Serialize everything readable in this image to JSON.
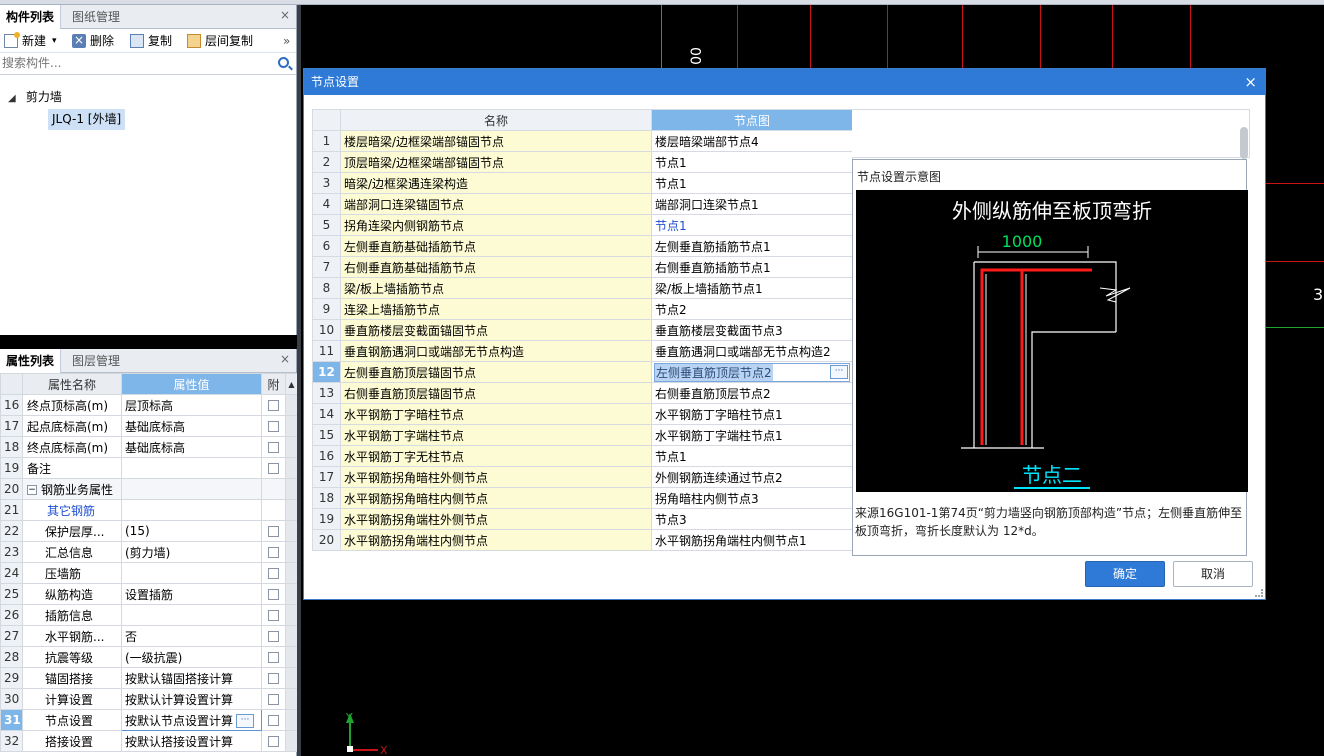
{
  "component_panel": {
    "tabs": [
      "构件列表",
      "图纸管理"
    ],
    "close": "×",
    "toolbar": {
      "new": "新建",
      "delete": "删除",
      "copy": "复制",
      "floor_copy": "层间复制",
      "more": "»"
    },
    "search_placeholder": "搜索构件...",
    "tree": {
      "root": "剪力墙",
      "child": "JLQ-1 [外墙]"
    }
  },
  "property_panel": {
    "tabs": [
      "属性列表",
      "图层管理"
    ],
    "close": "×",
    "headers": {
      "name": "属性名称",
      "value": "属性值",
      "extra": "附"
    },
    "rows": [
      {
        "num": "16",
        "name": "终点顶标高(m)",
        "value": "层顶标高",
        "check": true
      },
      {
        "num": "17",
        "name": "起点底标高(m)",
        "value": "基础底标高",
        "check": true
      },
      {
        "num": "18",
        "name": "终点底标高(m)",
        "value": "基础底标高",
        "check": true
      },
      {
        "num": "19",
        "name": "备注",
        "value": "",
        "check": true
      },
      {
        "num": "20",
        "name": "钢筋业务属性",
        "value": "",
        "check": false,
        "group": true
      },
      {
        "num": "21",
        "name": "其它钢筋",
        "value": "",
        "check": false,
        "link": true
      },
      {
        "num": "22",
        "name": "保护层厚...",
        "value": "(15)",
        "check": true
      },
      {
        "num": "23",
        "name": "汇总信息",
        "value": "(剪力墙)",
        "check": true
      },
      {
        "num": "24",
        "name": "压墙筋",
        "value": "",
        "check": true
      },
      {
        "num": "25",
        "name": "纵筋构造",
        "value": "设置插筋",
        "check": true
      },
      {
        "num": "26",
        "name": "插筋信息",
        "value": "",
        "check": true
      },
      {
        "num": "27",
        "name": "水平钢筋...",
        "value": "否",
        "check": true
      },
      {
        "num": "28",
        "name": "抗震等级",
        "value": "(一级抗震)",
        "check": true
      },
      {
        "num": "29",
        "name": "锚固搭接",
        "value": "按默认锚固搭接计算",
        "check": true
      },
      {
        "num": "30",
        "name": "计算设置",
        "value": "按默认计算设置计算",
        "check": true
      },
      {
        "num": "31",
        "name": "节点设置",
        "value": "按默认节点设置计算",
        "check": true,
        "selected": true
      },
      {
        "num": "32",
        "name": "搭接设置",
        "value": "按默认搭接设置计算",
        "check": true
      }
    ]
  },
  "dialog": {
    "title": "节点设置",
    "close": "×",
    "headers": {
      "name": "名称",
      "image": "节点图"
    },
    "rows": [
      {
        "num": "1",
        "name": "楼层暗梁/边框梁端部锚固节点",
        "image": "楼层暗梁端部节点4"
      },
      {
        "num": "2",
        "name": "顶层暗梁/边框梁端部锚固节点",
        "image": "节点1"
      },
      {
        "num": "3",
        "name": "暗梁/边框梁遇连梁构造",
        "image": "节点1"
      },
      {
        "num": "4",
        "name": "端部洞口连梁锚固节点",
        "image": "端部洞口连梁节点1"
      },
      {
        "num": "5",
        "name": "拐角连梁内侧钢筋节点",
        "image": "节点1",
        "link": true
      },
      {
        "num": "6",
        "name": "左侧垂直筋基础插筋节点",
        "image": "左侧垂直筋插筋节点1"
      },
      {
        "num": "7",
        "name": "右侧垂直筋基础插筋节点",
        "image": "右侧垂直筋插筋节点1"
      },
      {
        "num": "8",
        "name": "梁/板上墙插筋节点",
        "image": "梁/板上墙插筋节点1"
      },
      {
        "num": "9",
        "name": "连梁上墙插筋节点",
        "image": "节点2"
      },
      {
        "num": "10",
        "name": "垂直筋楼层变截面锚固节点",
        "image": "垂直筋楼层变截面节点3"
      },
      {
        "num": "11",
        "name": "垂直钢筋遇洞口或端部无节点构造",
        "image": "垂直筋遇洞口或端部无节点构造2"
      },
      {
        "num": "12",
        "name": "左侧垂直筋顶层锚固节点",
        "image": "左侧垂直筋顶层节点2",
        "selected": true
      },
      {
        "num": "13",
        "name": "右侧垂直筋顶层锚固节点",
        "image": "右侧垂直筋顶层节点2"
      },
      {
        "num": "14",
        "name": "水平钢筋丁字暗柱节点",
        "image": "水平钢筋丁字暗柱节点1"
      },
      {
        "num": "15",
        "name": "水平钢筋丁字端柱节点",
        "image": "水平钢筋丁字端柱节点1"
      },
      {
        "num": "16",
        "name": "水平钢筋丁字无柱节点",
        "image": "节点1"
      },
      {
        "num": "17",
        "name": "水平钢筋拐角暗柱外侧节点",
        "image": "外侧钢筋连续通过节点2"
      },
      {
        "num": "18",
        "name": "水平钢筋拐角暗柱内侧节点",
        "image": "拐角暗柱内侧节点3"
      },
      {
        "num": "19",
        "name": "水平钢筋拐角端柱外侧节点",
        "image": "节点3"
      },
      {
        "num": "20",
        "name": "水平钢筋拐角端柱内侧节点",
        "image": "水平钢筋拐角端柱内侧节点1"
      }
    ],
    "preview": {
      "title": "节点设置示意图",
      "diagram_title": "外侧纵筋伸至板顶弯折",
      "dimension": "1000",
      "node_label": "节点二",
      "description": "来源16G101-1第74页“剪力墙竖向钢筋顶部构造”节点；左侧垂直筋伸至板顶弯折，弯折长度默认为 12*d。"
    },
    "ok": "确定",
    "cancel": "取消"
  },
  "canvas": {
    "label_top": "00",
    "label_right": "3",
    "axis_y": "Y",
    "axis_x": "X"
  },
  "colors": {
    "accent": "#2f7ad6",
    "header_blue": "#7fb6e9",
    "name_cell": "#fdfbd3",
    "rebar_red": "#ff0000",
    "node_cyan": "#00e5ff"
  }
}
